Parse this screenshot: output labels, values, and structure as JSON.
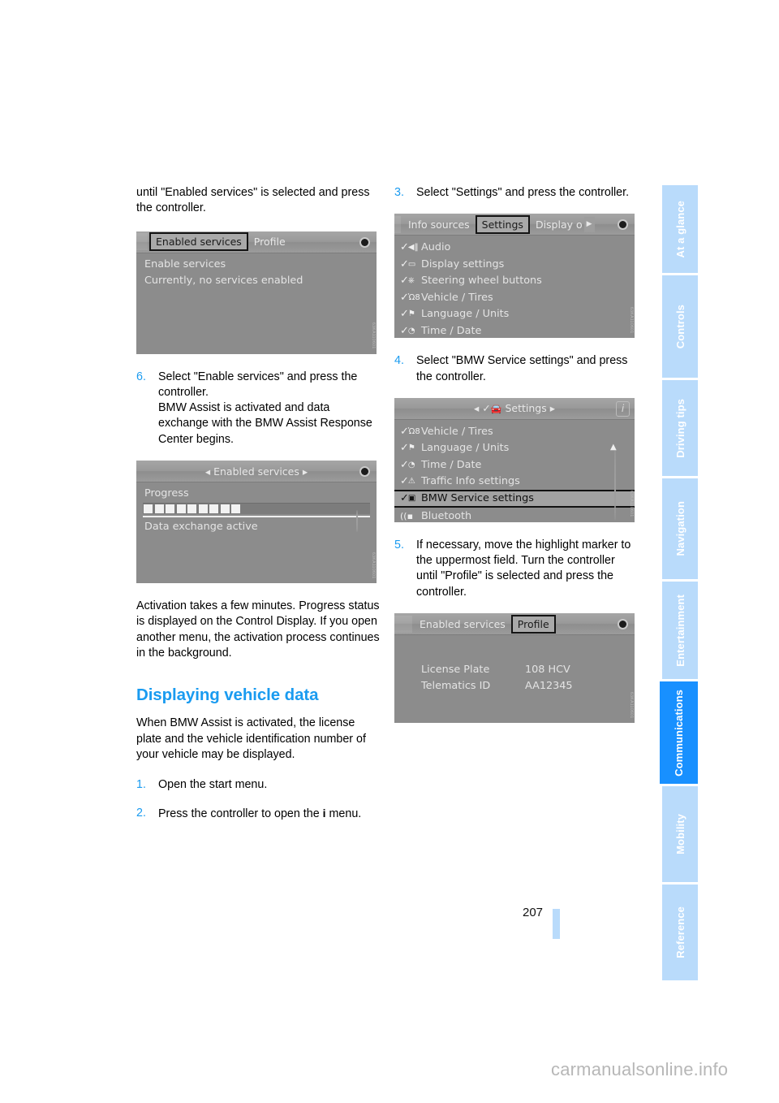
{
  "page": {
    "number": "207",
    "watermark": "carmanualsonline.info"
  },
  "left_column": {
    "intro_para": "until \"Enabled services\" is selected and press the controller.",
    "shot1": {
      "name": "enabled-services-screen",
      "tab_selected": "Enabled services",
      "tab_other": "Profile",
      "line1": "Enable services",
      "line2": "Currently, no services enabled",
      "watermark": "63KA110601"
    },
    "step6": {
      "num": "6.",
      "text": "Select \"Enable services\" and press the controller.\nBMW Assist is activated and data exchange with the BMW Assist Response Center begins."
    },
    "shot2": {
      "name": "progress-screen",
      "title": "Enabled services",
      "label_progress": "Progress",
      "blocks": 9,
      "status": "Data exchange active",
      "watermark": "63KA110601"
    },
    "para_activation": "Activation takes a few minutes. Progress status is displayed on the Control Display. If you open another menu, the activation process continues in the background.",
    "section_title": "Displaying vehicle data",
    "para_when": "When BMW Assist is activated, the license plate and the vehicle identification number of your vehicle may be displayed.",
    "step1": {
      "num": "1.",
      "text": "Open the start menu."
    },
    "step2": {
      "num": "2.",
      "text_before": "Press the controller to open the ",
      "icon": "i",
      "text_after": " menu."
    }
  },
  "right_column": {
    "step3": {
      "num": "3.",
      "text": "Select \"Settings\" and press the controller."
    },
    "shot3": {
      "name": "settings-tab-screen",
      "tab_left": "Info sources",
      "tab_selected": "Settings",
      "tab_right": "Display o",
      "items": [
        {
          "label": "Audio",
          "icon": "check-speaker-icon"
        },
        {
          "label": "Display settings",
          "icon": "check-monitor-icon"
        },
        {
          "label": "Steering wheel buttons",
          "icon": "check-steering-wheel-icon"
        },
        {
          "label": "Vehicle / Tires",
          "icon": "check-car-icon"
        },
        {
          "label": "Language / Units",
          "icon": "check-flag-icon"
        },
        {
          "label": "Time / Date",
          "icon": "check-clock-icon"
        }
      ],
      "watermark": "63KA110601"
    },
    "step4": {
      "num": "4.",
      "text": "Select \"BMW Service settings\" and press the controller."
    },
    "shot4": {
      "name": "settings-menu-screen",
      "title": "Settings",
      "items": [
        {
          "label": "Vehicle / Tires",
          "icon": "check-car-icon",
          "highlighted": false
        },
        {
          "label": "Language / Units",
          "icon": "check-flag-icon",
          "highlighted": false
        },
        {
          "label": "Time / Date",
          "icon": "check-clock-icon",
          "highlighted": false
        },
        {
          "label": "Traffic Info settings",
          "icon": "check-warning-icon",
          "highlighted": false
        },
        {
          "label": "BMW Service settings",
          "icon": "check-service-icon",
          "highlighted": true
        },
        {
          "label": "Bluetooth",
          "icon": "bluetooth-signal-icon",
          "highlighted": false
        }
      ],
      "watermark": "63KA110601"
    },
    "step5": {
      "num": "5.",
      "text": "If necessary, move the highlight marker to the uppermost field. Turn the controller until \"Profile\" is selected and press the controller."
    },
    "shot5": {
      "name": "profile-screen",
      "tab_left": "Enabled services",
      "tab_selected": "Profile",
      "rows": [
        {
          "key": "License Plate",
          "value": "108 HCV"
        },
        {
          "key": "Telematics ID",
          "value": "AA12345"
        }
      ],
      "watermark": "63KA110601"
    }
  },
  "sidebar": {
    "tabs": [
      {
        "label": "At a glance",
        "active": false
      },
      {
        "label": "Controls",
        "active": false
      },
      {
        "label": "Driving tips",
        "active": false
      },
      {
        "label": "Navigation",
        "active": false
      },
      {
        "label": "Entertainment",
        "active": false
      },
      {
        "label": "Communications",
        "active": true
      },
      {
        "label": "Mobility",
        "active": false
      },
      {
        "label": "Reference",
        "active": false
      }
    ],
    "accent_active": "#1890ff",
    "accent_inactive": "#b9dbfb"
  }
}
